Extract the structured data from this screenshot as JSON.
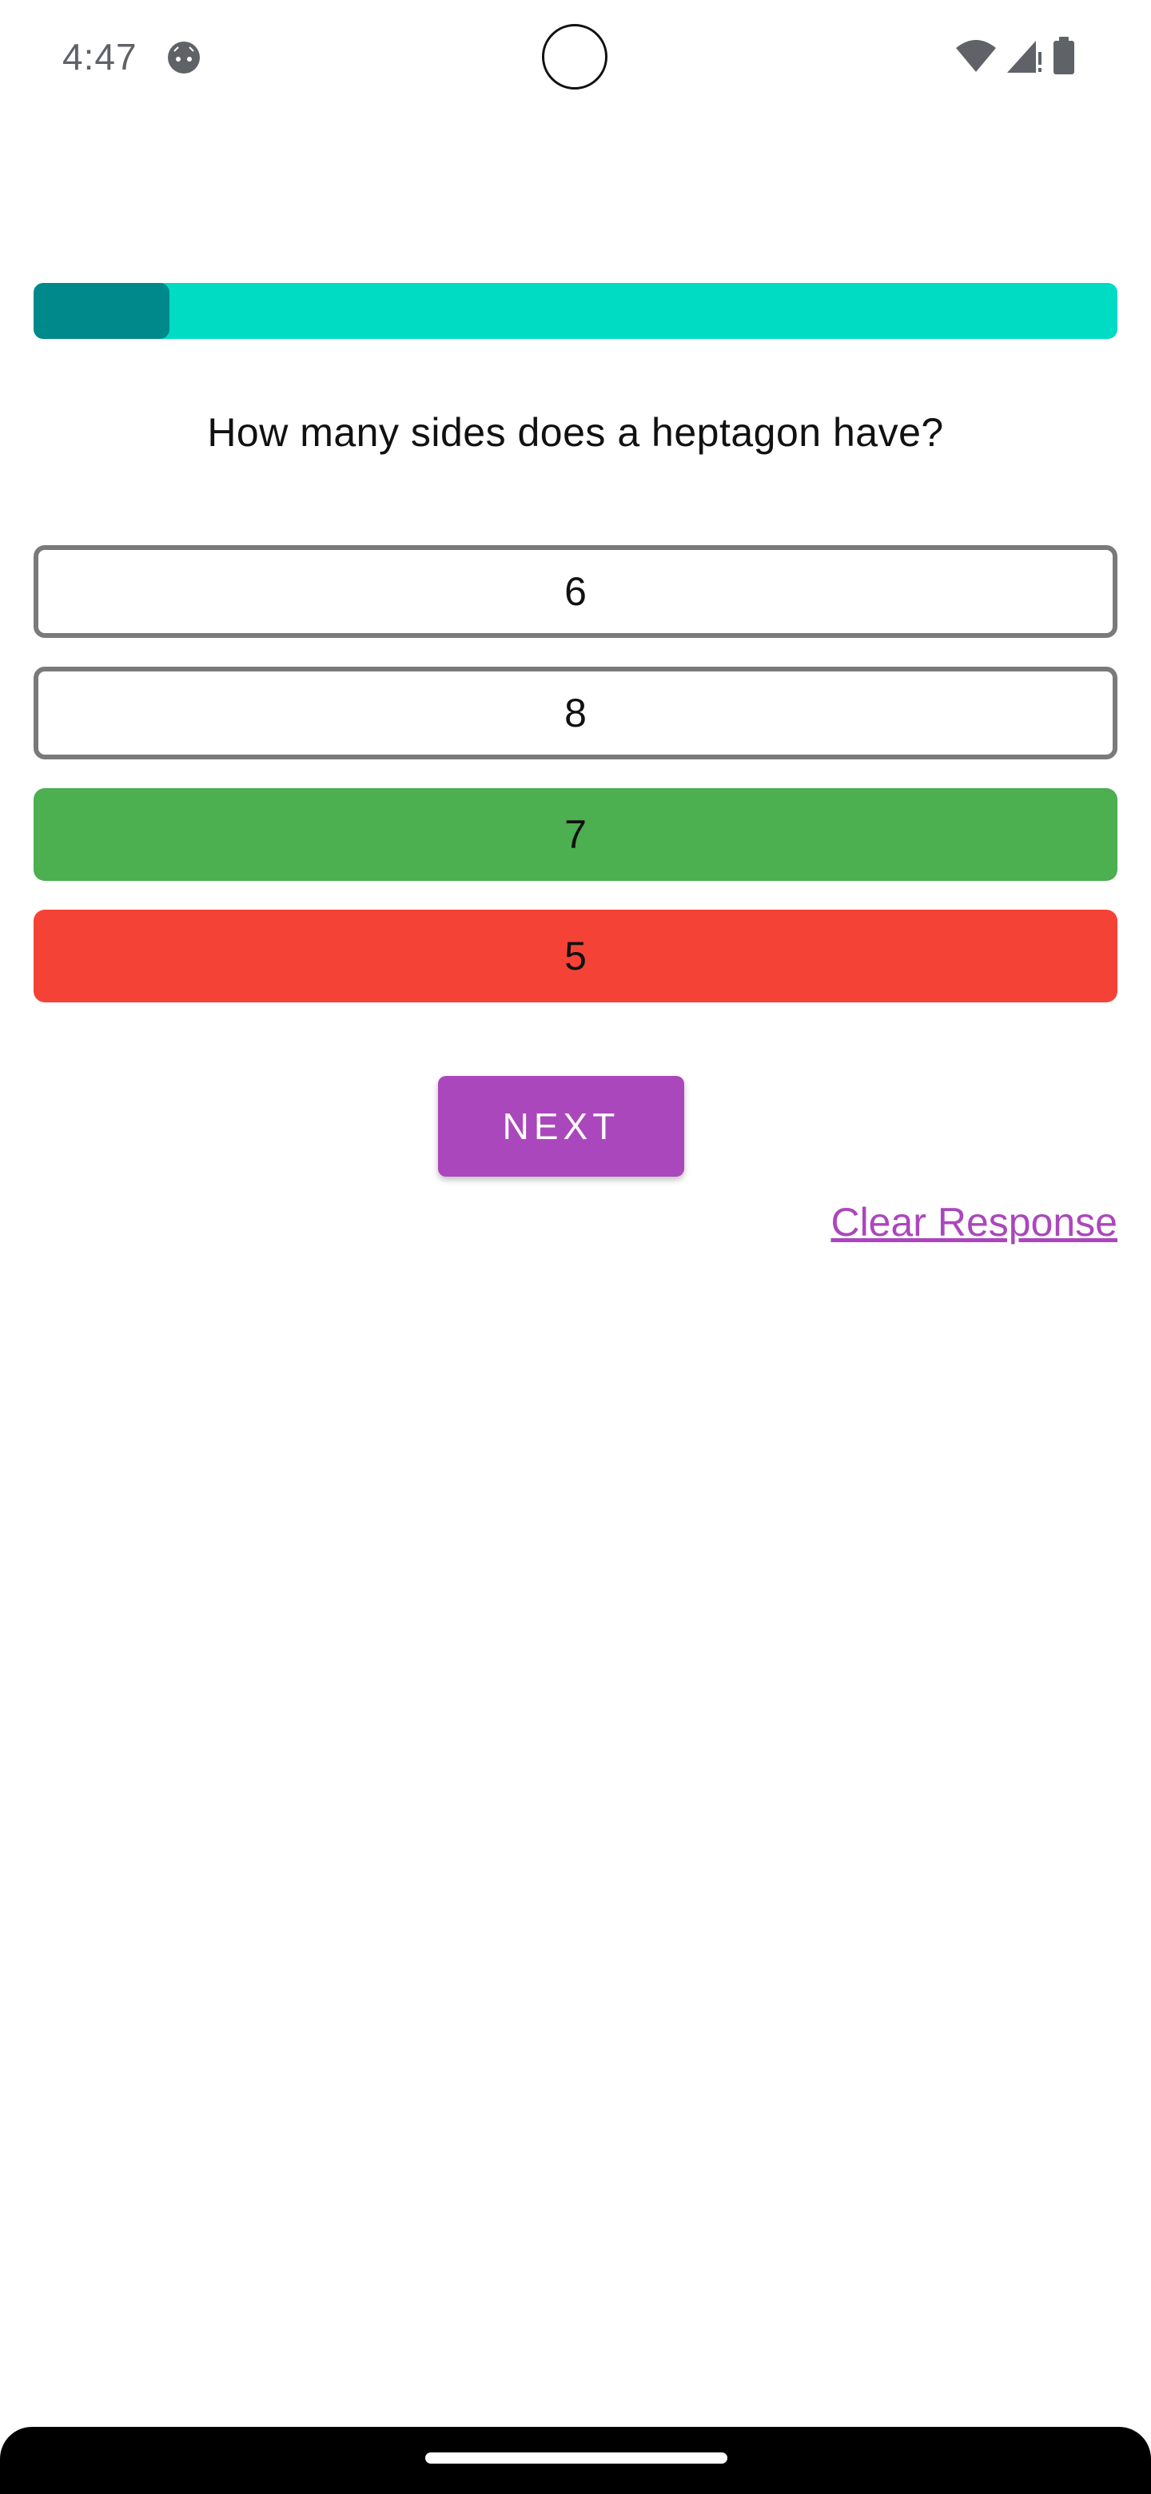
{
  "status_bar": {
    "time": "4:47",
    "app_icon": "android-face-icon",
    "icons": [
      "wifi-icon",
      "signal-icon",
      "battery-icon"
    ]
  },
  "progress": {
    "value": 0.125,
    "track_color": "#00DBC4",
    "fill_color": "#00898A"
  },
  "question": {
    "text": "How many sides does a heptagon have?"
  },
  "options": [
    {
      "label": "6",
      "state": "default"
    },
    {
      "label": "8",
      "state": "default"
    },
    {
      "label": "7",
      "state": "correct"
    },
    {
      "label": "5",
      "state": "incorrect"
    }
  ],
  "colors": {
    "correct": "#4CAF50",
    "incorrect": "#F44336",
    "accent": "#AB47BC"
  },
  "actions": {
    "next_label": "NEXT",
    "clear_label": "Clear Response"
  }
}
